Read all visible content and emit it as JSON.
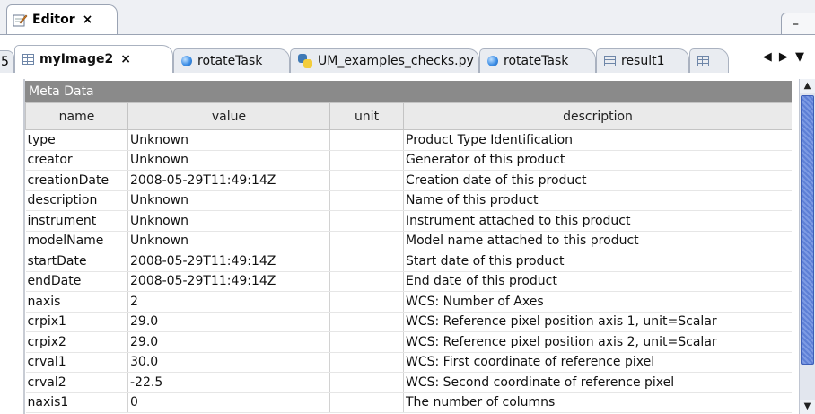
{
  "editor_view": {
    "title": "Editor",
    "close_glyph": "×",
    "win_ctrl": "–"
  },
  "tabs": {
    "overflow_index": "5",
    "items": [
      {
        "label": "myImage2",
        "icon": "table-icon",
        "active": true,
        "close": "×"
      },
      {
        "label": "rotateTask",
        "icon": "task-ball-icon"
      },
      {
        "label": "UM_examples_checks.py",
        "icon": "python-icon"
      },
      {
        "label": "rotateTask",
        "icon": "task-ball-icon"
      },
      {
        "label": "result1",
        "icon": "table-icon"
      }
    ],
    "nav_glyph": "◀ ▶ ▼"
  },
  "meta_data": {
    "title": "Meta Data",
    "columns": [
      "name",
      "value",
      "unit",
      "description"
    ],
    "rows": [
      [
        "type",
        "Unknown",
        "",
        "Product Type Identification"
      ],
      [
        "creator",
        "Unknown",
        "",
        "Generator of this product"
      ],
      [
        "creationDate",
        "2008-05-29T11:49:14Z",
        "",
        "Creation date of this product"
      ],
      [
        "description",
        "Unknown",
        "",
        "Name of this product"
      ],
      [
        "instrument",
        "Unknown",
        "",
        "Instrument attached to this product"
      ],
      [
        "modelName",
        "Unknown",
        "",
        "Model name attached to this product"
      ],
      [
        "startDate",
        "2008-05-29T11:49:14Z",
        "",
        "Start date of this product"
      ],
      [
        "endDate",
        "2008-05-29T11:49:14Z",
        "",
        "End date of this product"
      ],
      [
        "naxis",
        "2",
        "",
        "WCS: Number of Axes"
      ],
      [
        "crpix1",
        "29.0",
        "",
        "WCS: Reference pixel position axis 1, unit=Scalar"
      ],
      [
        "crpix2",
        "29.0",
        "",
        "WCS: Reference pixel position axis 2, unit=Scalar"
      ],
      [
        "crval1",
        "30.0",
        "",
        "WCS: First coordinate of reference pixel"
      ],
      [
        "crval2",
        "-22.5",
        "",
        "WCS: Second coordinate of reference pixel"
      ],
      [
        "naxis1",
        "0",
        "",
        "The number of columns"
      ]
    ]
  },
  "scrollbar": {
    "up": "▲",
    "down": "▼"
  },
  "colors": {
    "header_bg": "#8a8a8a",
    "scroll_thumb": "#5d7fd6",
    "tab_border": "#9aa3b3"
  }
}
